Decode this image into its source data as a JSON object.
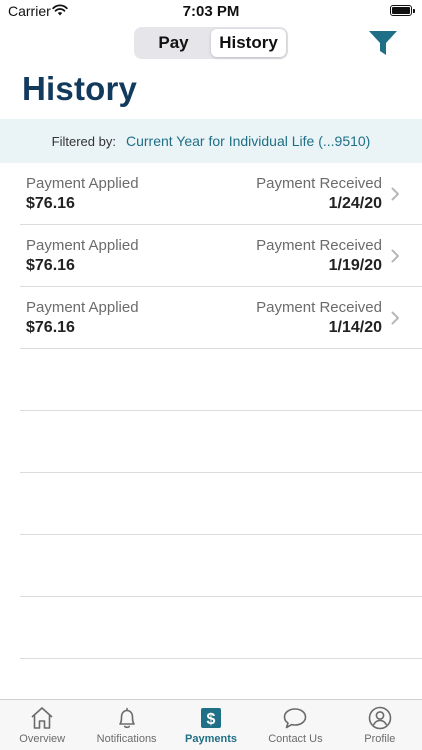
{
  "status_bar": {
    "carrier": "Carrier",
    "time": "7:03 PM"
  },
  "segmented": {
    "pay_label": "Pay",
    "history_label": "History",
    "selected": "History"
  },
  "page": {
    "title": "History"
  },
  "filter": {
    "label": "Filtered by:",
    "value": "Current Year for Individual Life (...9510)"
  },
  "payments": [
    {
      "left_label": "Payment Applied",
      "amount": "$76.16",
      "right_label": "Payment Received",
      "date": "1/24/20"
    },
    {
      "left_label": "Payment Applied",
      "amount": "$76.16",
      "right_label": "Payment Received",
      "date": "1/19/20"
    },
    {
      "left_label": "Payment Applied",
      "amount": "$76.16",
      "right_label": "Payment Received",
      "date": "1/14/20"
    }
  ],
  "tabs": [
    {
      "label": "Overview",
      "icon": "home-icon"
    },
    {
      "label": "Notifications",
      "icon": "bell-icon"
    },
    {
      "label": "Payments",
      "icon": "dollar-icon",
      "active": true
    },
    {
      "label": "Contact Us",
      "icon": "chat-bubble-icon"
    },
    {
      "label": "Profile",
      "icon": "user-circle-icon"
    }
  ],
  "colors": {
    "accent": "#1f6f86",
    "title": "#123a5c",
    "filter_bg": "#eaf4f6"
  }
}
